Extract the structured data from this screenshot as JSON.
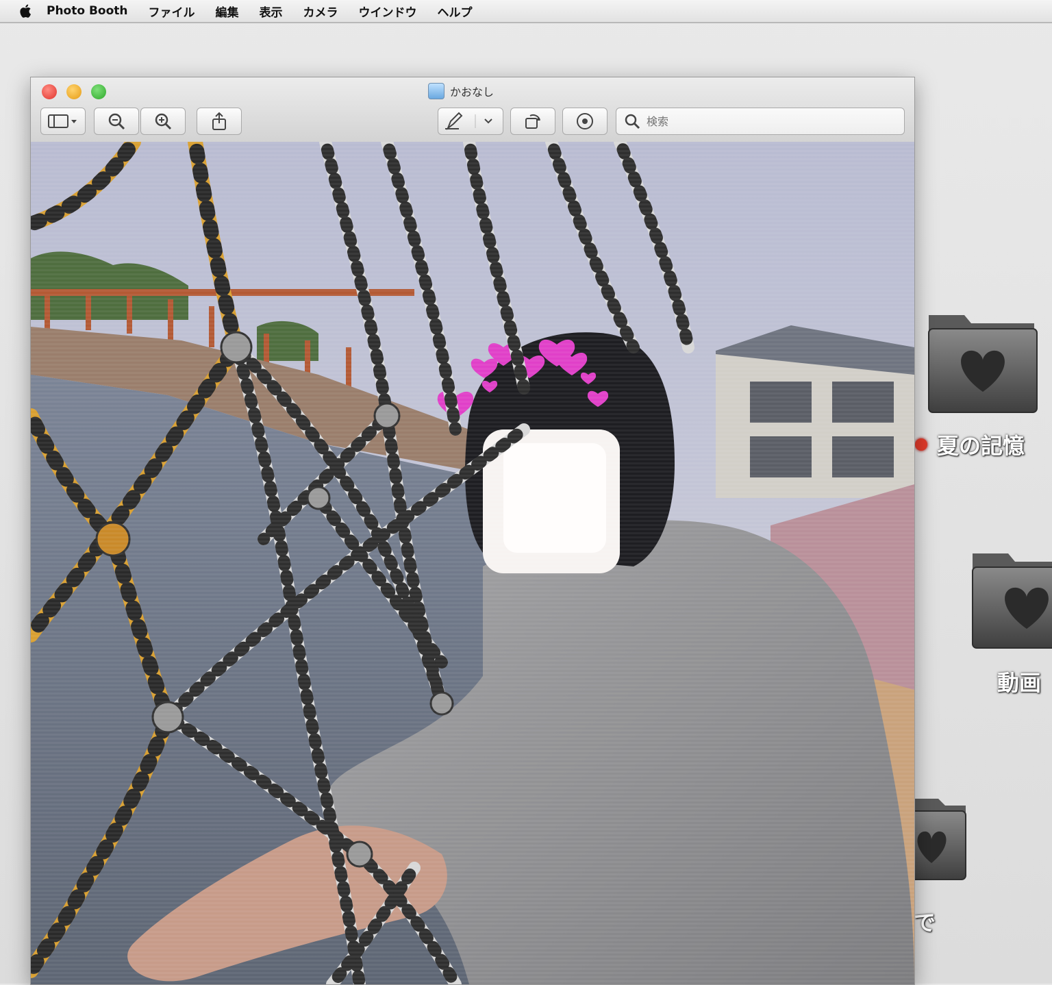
{
  "menubar": {
    "app": "Photo Booth",
    "items": [
      "ファイル",
      "編集",
      "表示",
      "カメラ",
      "ウインドウ",
      "ヘルプ"
    ]
  },
  "window": {
    "title": "かおなし",
    "search_placeholder": "検索"
  },
  "desktop": {
    "folders": [
      {
        "label": "夏の記憶"
      },
      {
        "label": "動画"
      },
      {
        "label": "で"
      }
    ]
  },
  "icons": {
    "view": "sidebar-view-icon",
    "zoom_out": "zoom-out-icon",
    "zoom_in": "zoom-in-icon",
    "share": "share-icon",
    "markup": "pen-icon",
    "rotate": "rotate-icon",
    "annotate": "annotate-icon",
    "search": "search-icon"
  },
  "colors": {
    "folder_tag": "#e23b2b",
    "heart": "#e040c8"
  }
}
